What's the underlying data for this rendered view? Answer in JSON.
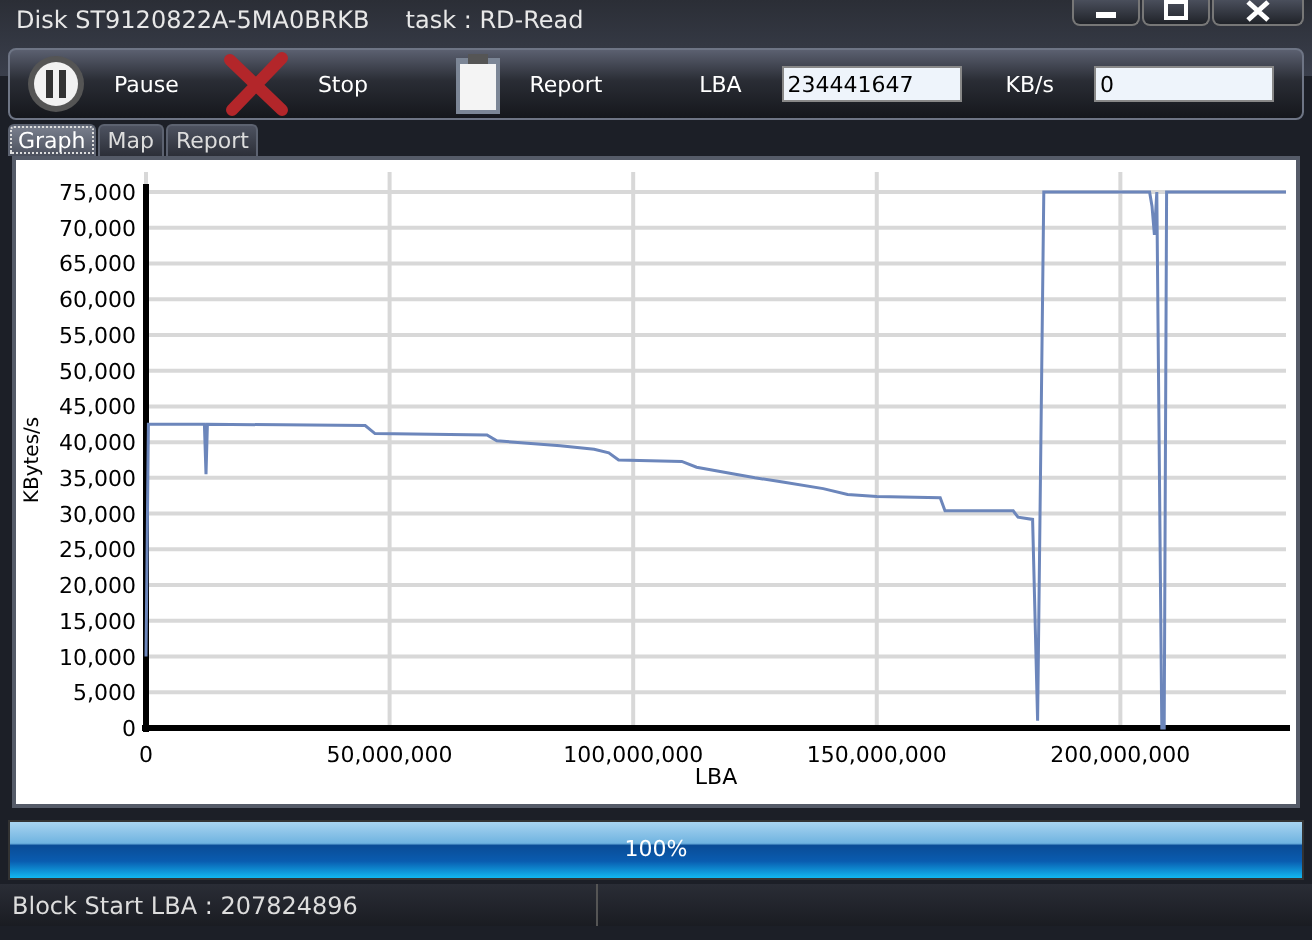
{
  "window": {
    "disk": "Disk ST9120822A-5MA0BRKB",
    "task": "task : RD-Read"
  },
  "toolbar": {
    "buttons": [
      {
        "kind": "pause",
        "label": "Pause"
      },
      {
        "kind": "stop",
        "label": "Stop"
      },
      {
        "kind": "report",
        "label": "Report"
      }
    ],
    "fields": [
      {
        "label": "LBA",
        "value": "234441647"
      },
      {
        "label": "KB/s",
        "value": "0"
      }
    ]
  },
  "tabs": [
    {
      "label": "Graph",
      "selected": true
    },
    {
      "label": "Map",
      "selected": false
    },
    {
      "label": "Report",
      "selected": false
    }
  ],
  "graph": {
    "chart_data": {
      "type": "line",
      "grid": true,
      "xlabel": "LBA",
      "ylabel": "KBytes/s",
      "xlim": [
        0,
        234000000
      ],
      "ylim": [
        0,
        75000
      ],
      "xticks": [
        {
          "value": 0,
          "label": "0"
        },
        {
          "value": 50000000,
          "label": "50,000,000"
        },
        {
          "value": 100000000,
          "label": "100,000,000"
        },
        {
          "value": 150000000,
          "label": "150,000,000"
        },
        {
          "value": 200000000,
          "label": "200,000,000"
        }
      ],
      "yticks": [
        {
          "value": 0,
          "label": "0"
        },
        {
          "value": 5000,
          "label": "5,000"
        },
        {
          "value": 10000,
          "label": "10,000"
        },
        {
          "value": 15000,
          "label": "15,000"
        },
        {
          "value": 20000,
          "label": "20,000"
        },
        {
          "value": 25000,
          "label": "25,000"
        },
        {
          "value": 30000,
          "label": "30,000"
        },
        {
          "value": 35000,
          "label": "35,000"
        },
        {
          "value": 40000,
          "label": "40,000"
        },
        {
          "value": 45000,
          "label": "45,000"
        },
        {
          "value": 50000,
          "label": "50,000"
        },
        {
          "value": 55000,
          "label": "55,000"
        },
        {
          "value": 60000,
          "label": "60,000"
        },
        {
          "value": 65000,
          "label": "65,000"
        },
        {
          "value": 70000,
          "label": "70,000"
        },
        {
          "value": 75000,
          "label": "75,000"
        }
      ],
      "x": [
        0,
        500000,
        12000000,
        12300000,
        12600000,
        45000000,
        47000000,
        70000000,
        72000000,
        85000000,
        92000000,
        95000000,
        97000000,
        110000000,
        113000000,
        117000000,
        121000000,
        125000000,
        131000000,
        139000000,
        144000000,
        150000000,
        163000000,
        164000000,
        178000000,
        179000000,
        182000000,
        183000000,
        184300000,
        206000000,
        206500000,
        207000000,
        207500000,
        208500000,
        209000000,
        209500000,
        234000000
      ],
      "series": [
        {
          "color": "#6c86bb",
          "values": [
            10000,
            42500,
            42500,
            35500,
            42500,
            42300,
            41200,
            41000,
            40200,
            39500,
            39000,
            38500,
            37500,
            37300,
            36500,
            36000,
            35500,
            35000,
            34400,
            33500,
            32700,
            32400,
            32200,
            30400,
            30400,
            29500,
            29200,
            1000,
            75000,
            75000,
            73000,
            69000,
            75000,
            0,
            0,
            75000,
            75000
          ]
        }
      ]
    }
  },
  "progress": {
    "level": 1.0,
    "text": "100%"
  },
  "status_bar": {
    "text": "Block Start LBA : 207824896"
  }
}
